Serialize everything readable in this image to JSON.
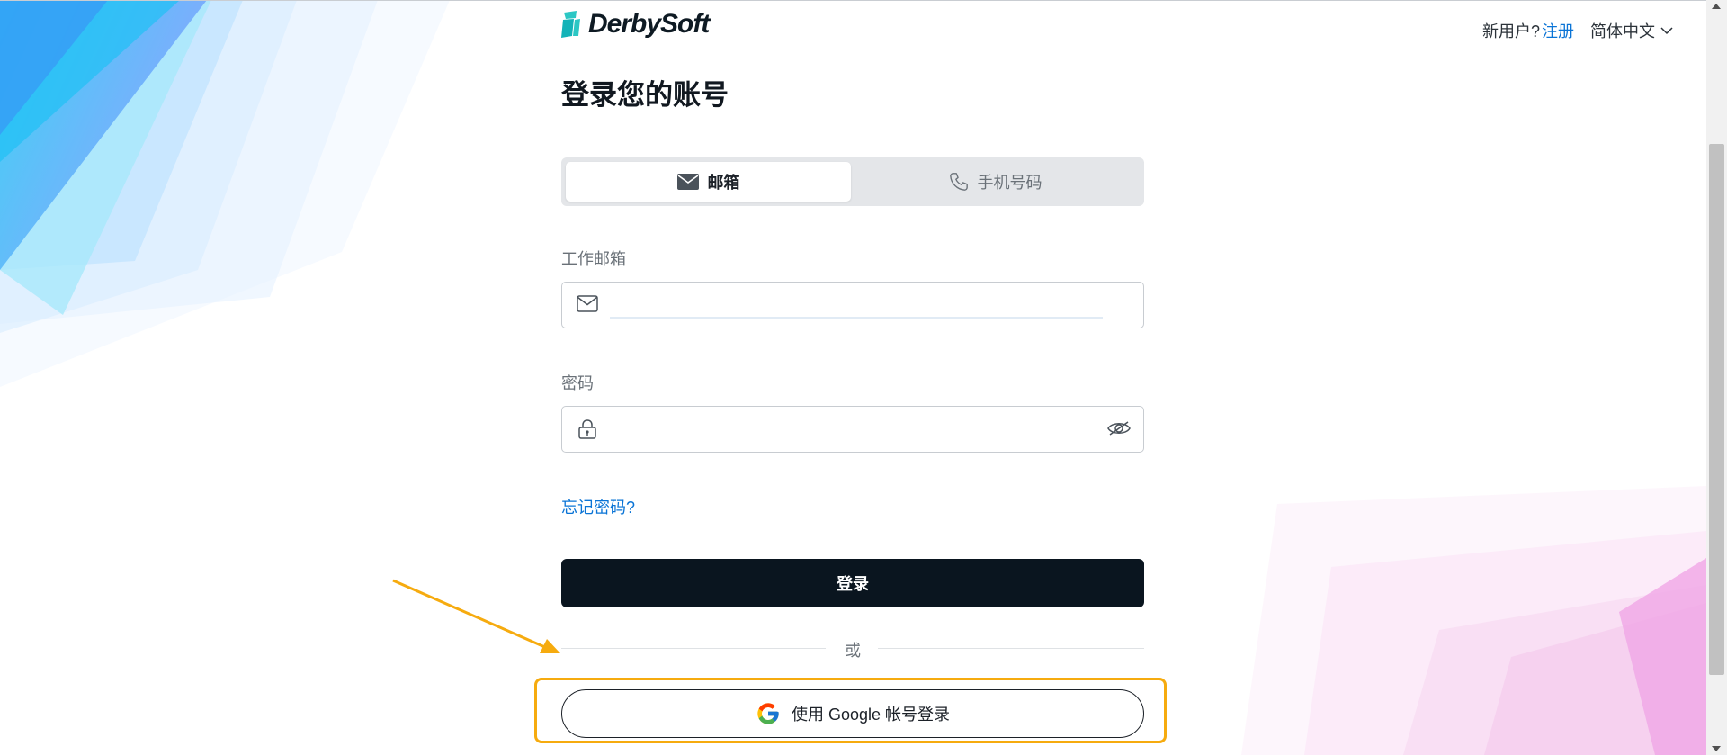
{
  "header": {
    "logo_text": "DerbySoft",
    "new_user_text": "新用户?",
    "register_link": "注册",
    "language": "简体中文"
  },
  "form": {
    "title": "登录您的账号",
    "tabs": [
      {
        "label": "邮箱",
        "icon": "envelope-icon",
        "active": true
      },
      {
        "label": "手机号码",
        "icon": "phone-icon",
        "active": false
      }
    ],
    "email_label": "工作邮箱",
    "email_value": "",
    "password_label": "密码",
    "password_value": "",
    "forgot_password": "忘记密码?",
    "login_button": "登录",
    "divider_text": "或",
    "google_button": "使用 Google 帐号登录"
  },
  "colors": {
    "accent_link": "#0a74d6",
    "login_button_bg": "#0a151f",
    "highlight_annotation": "#f6ab0f"
  }
}
